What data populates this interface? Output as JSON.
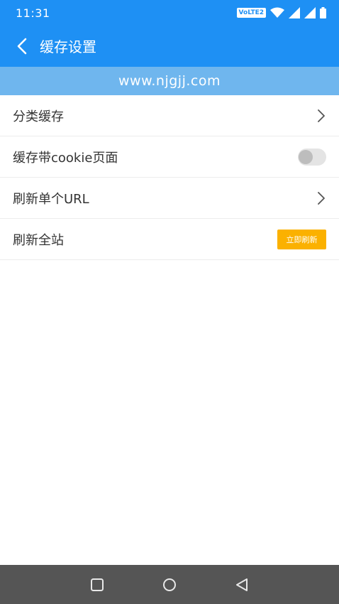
{
  "status_bar": {
    "time": "11:31",
    "volte_label": "VoLTE2",
    "icons": [
      "wifi-icon",
      "signal-icon",
      "signal-icon",
      "battery-icon"
    ]
  },
  "app_bar": {
    "back_icon": "chevron-left-icon",
    "title": "缓存设置"
  },
  "banner": {
    "text": "www.njgjj.com"
  },
  "settings": {
    "items": [
      {
        "label": "分类缓存",
        "control": "chevron"
      },
      {
        "label": "缓存带cookie页面",
        "control": "toggle",
        "on": false
      },
      {
        "label": "刷新单个URL",
        "control": "chevron"
      },
      {
        "label": "刷新全站",
        "control": "button",
        "button_label": "立即刷新"
      }
    ]
  },
  "nav_bar": {
    "buttons": [
      "recents-icon",
      "home-icon",
      "back-icon"
    ]
  },
  "colors": {
    "primary": "#1e90f4",
    "banner": "#6fb6ee",
    "accent_button": "#fbb100",
    "navbar": "#555555"
  }
}
